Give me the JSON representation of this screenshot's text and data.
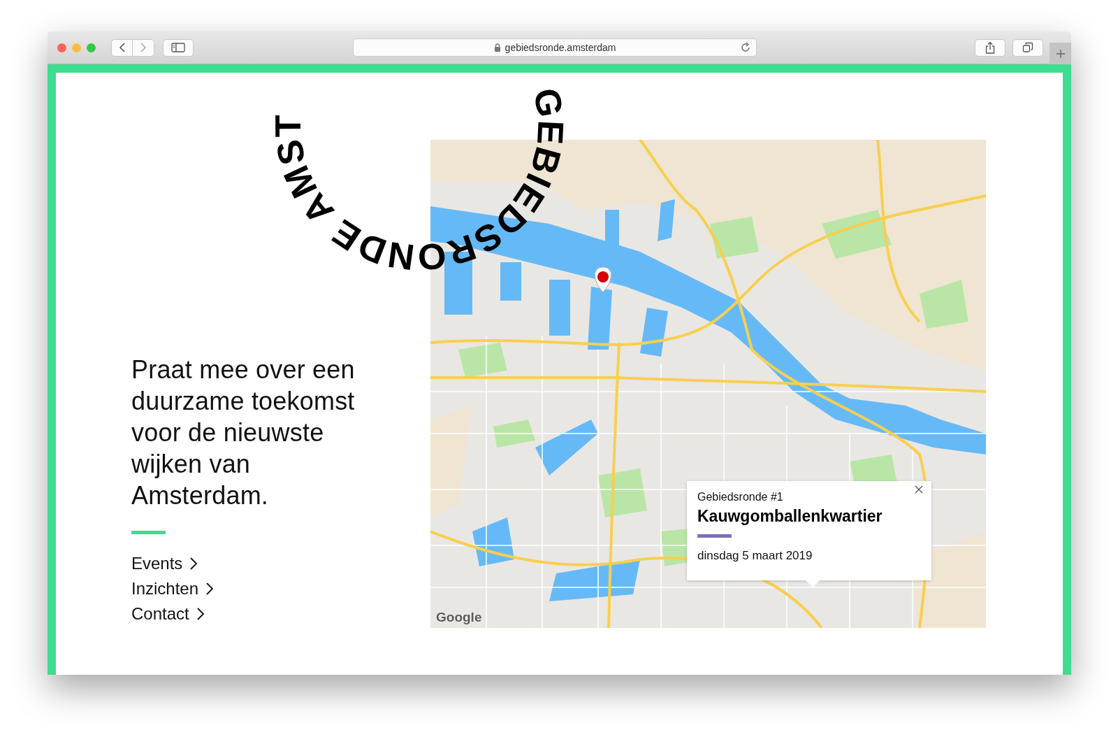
{
  "browser": {
    "url": "gebiedsronde.amsterdam"
  },
  "circle_text": "GEBIEDSRONDE AMST",
  "headline": "Praat mee over een duurzame toekomst voor de nieuwste wijken van Amsterdam.",
  "links": [
    {
      "label": "Events"
    },
    {
      "label": "Inzichten"
    },
    {
      "label": "Contact"
    }
  ],
  "map": {
    "attribution": "Google",
    "popup": {
      "kicker": "Gebiedsronde #1",
      "title": "Kauwgomballenkwartier",
      "date": "dinsdag 5 maart 2019"
    }
  }
}
